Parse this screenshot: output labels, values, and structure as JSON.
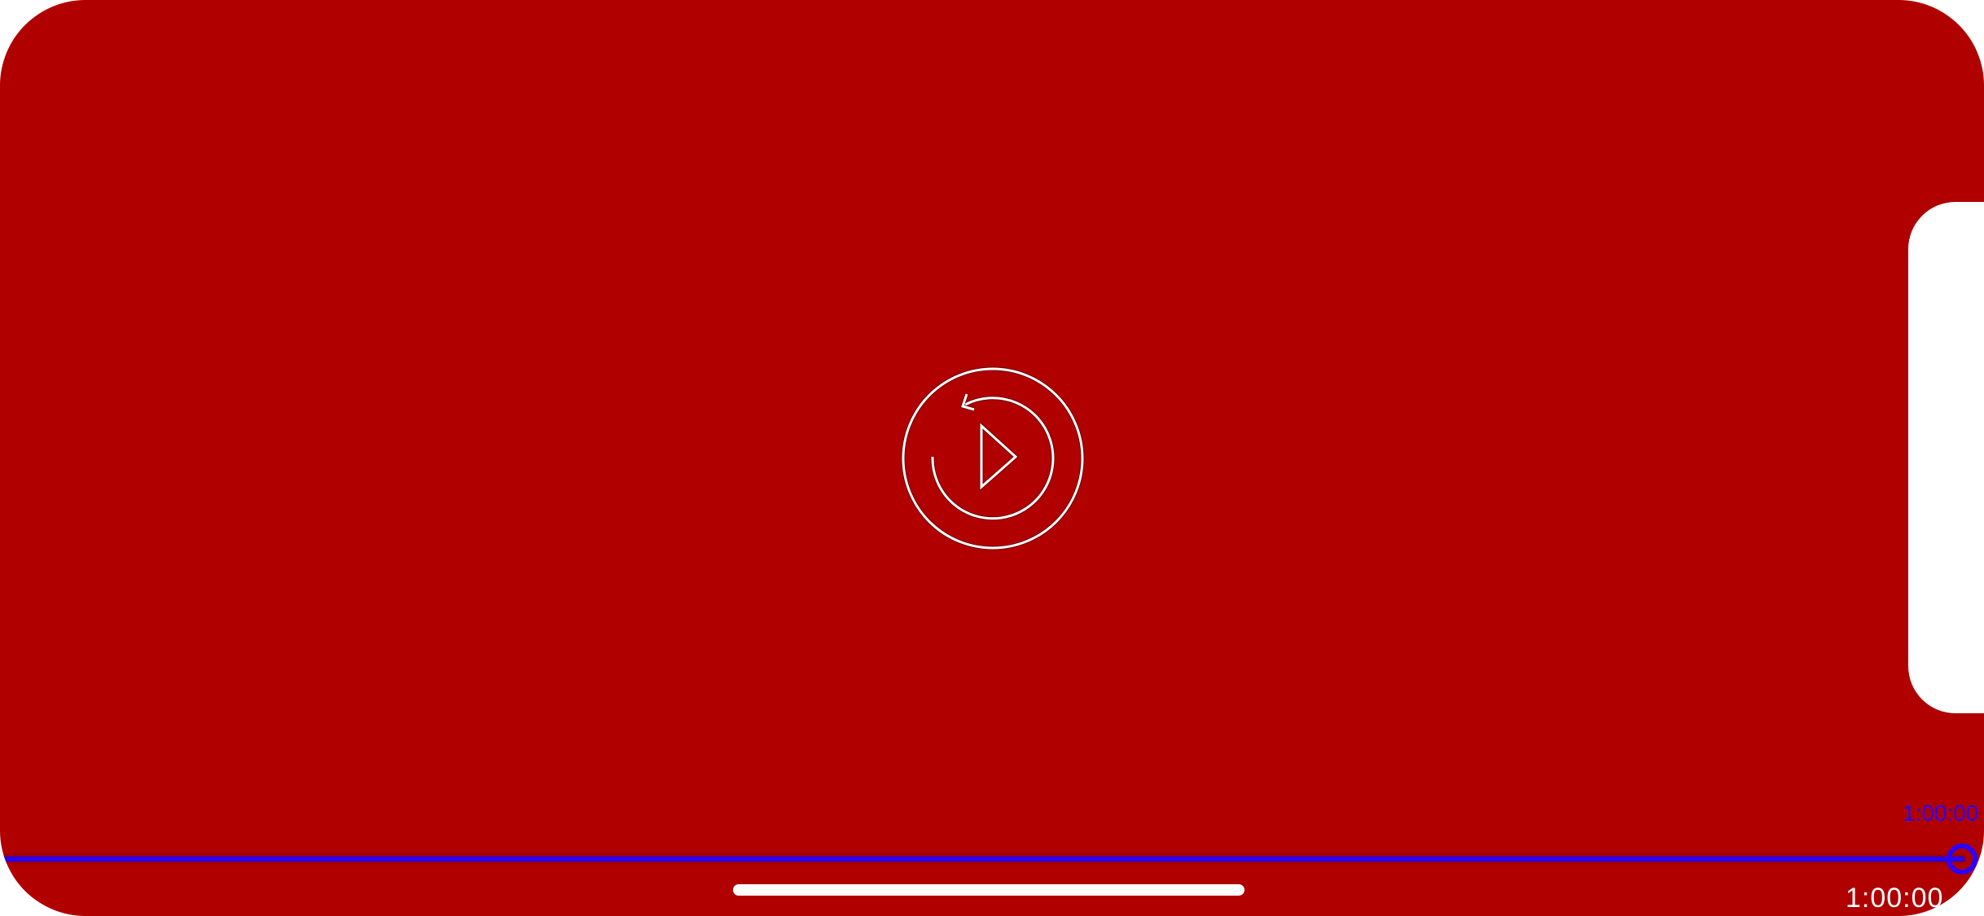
{
  "colors": {
    "background": "#b00000",
    "scrubber": "#2a00ff",
    "icon": "#ffffff"
  },
  "player": {
    "center_icon": "replay-play-icon",
    "progress": 1.0
  },
  "scrubber": {
    "thumb_time_label": "1:00:00",
    "remaining_time": "1:00:00"
  }
}
